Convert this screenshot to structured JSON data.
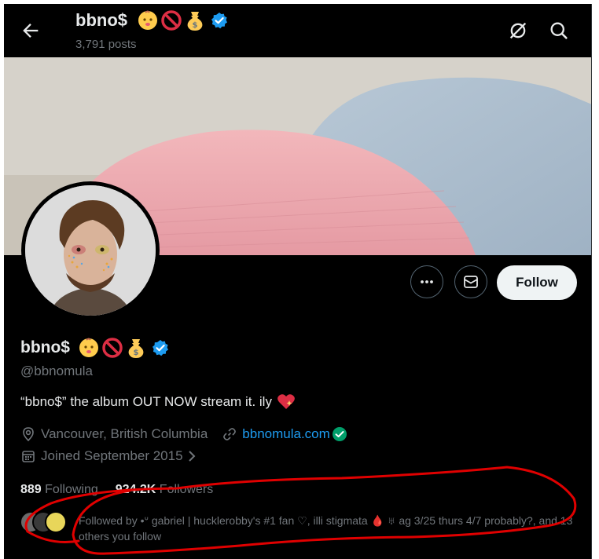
{
  "header": {
    "name": "bbno$",
    "posts": "3,791 posts",
    "emojis": [
      "baby-emoji",
      "no-entry-emoji",
      "money-bag-emoji"
    ]
  },
  "profile": {
    "display_name": "bbno$",
    "handle": "@bbnomula",
    "bio": "“bbno$” the album OUT NOW stream it. ily",
    "location": "Vancouver, British Columbia",
    "website": "bbnomula.com",
    "joined": "Joined September 2015",
    "following_count": "889",
    "following_label": "Following",
    "followers_count": "924.2K",
    "followers_label": "Followers",
    "followed_by": "Followed by •ᐡ gabriel | hucklerobby's #1 fan ♡, illi stigmata 🩸 ♅ ag 3/25 thurs 4/7 probably?, and 13 others you follow"
  },
  "actions": {
    "follow_label": "Follow"
  },
  "colors": {
    "background": "#000000",
    "accent": "#1d9bf0",
    "verified_badge": "#1d9bf0",
    "annotation": "#e00000"
  }
}
